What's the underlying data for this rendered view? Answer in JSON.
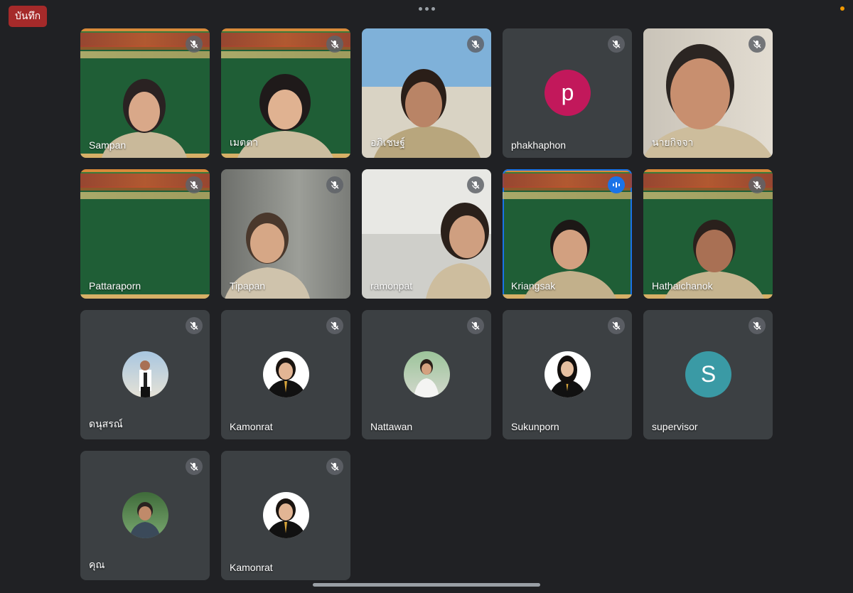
{
  "meeting": {
    "record_label": "บันทึก"
  },
  "colors": {
    "background": "#202124",
    "tile": "#3c4043",
    "record": "#a52a2a",
    "speaking": "#1a73e8"
  },
  "participants": [
    {
      "name": "Sampan",
      "muted": true
    },
    {
      "name": "เมตตา",
      "muted": true
    },
    {
      "name": "อภิเชษฐ์",
      "muted": true
    },
    {
      "name": "phakhaphon",
      "muted": true,
      "avatar_letter": "p",
      "avatar_color": "#c2185b"
    },
    {
      "name": "นายกิจจา",
      "muted": true
    },
    {
      "name": "Pattaraporn",
      "muted": true
    },
    {
      "name": "Tipapan",
      "muted": true
    },
    {
      "name": "ramonpat",
      "muted": true
    },
    {
      "name": "Kriangsak",
      "muted": false,
      "speaking": true
    },
    {
      "name": "Hathaichanok",
      "muted": true
    },
    {
      "name": "ดนุสรณ์",
      "muted": true
    },
    {
      "name": "Kamonrat",
      "muted": true
    },
    {
      "name": "Nattawan",
      "muted": true
    },
    {
      "name": "Sukunporn",
      "muted": true
    },
    {
      "name": "supervisor",
      "muted": true,
      "avatar_letter": "S",
      "avatar_color": "#3a9aa5"
    },
    {
      "name": "คุณ",
      "muted": true
    },
    {
      "name": "Kamonrat",
      "muted": true
    }
  ]
}
